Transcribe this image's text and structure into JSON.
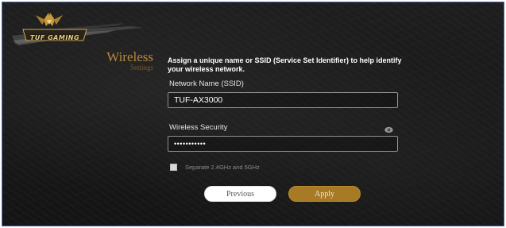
{
  "logo": {
    "text": "TUF GAMING"
  },
  "section": {
    "title": "Wireless",
    "subtitle": "Settings"
  },
  "description": "Assign a unique name or SSID (Service Set Identifier) to help identify your wireless network.",
  "ssid": {
    "label": "Network Name (SSID)",
    "value": "TUF-AX3000"
  },
  "security": {
    "label": "Wireless Security",
    "value": "•••••••••••",
    "toggle_icon": "eye-icon"
  },
  "separate_bands": {
    "label": "Separate 2.4GHz and 5GHz",
    "checked": false
  },
  "buttons": {
    "previous": "Previous",
    "apply": "Apply"
  },
  "colors": {
    "accent_gold": "#a77a26",
    "title_gold": "#b9893a",
    "background": "#181818"
  }
}
